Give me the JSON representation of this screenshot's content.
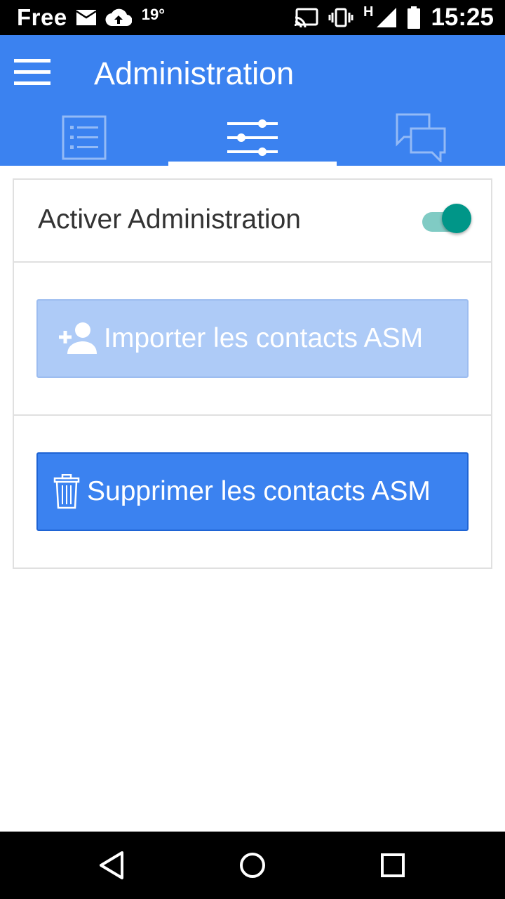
{
  "status_bar": {
    "carrier": "Free",
    "temperature": "19°",
    "network_type": "H",
    "time": "15:25"
  },
  "app_bar": {
    "title": "Administration",
    "tabs": [
      {
        "icon": "list-icon",
        "active": false
      },
      {
        "icon": "sliders-icon",
        "active": true
      },
      {
        "icon": "chat-icon",
        "active": false
      }
    ]
  },
  "admin": {
    "toggle_label": "Activer Administration",
    "toggle_on": true,
    "import_label": "Importer les contacts ASM",
    "import_enabled": false,
    "delete_label": "Supprimer les contacts ASM",
    "delete_enabled": true
  },
  "colors": {
    "primary": "#3b82f0",
    "primary_disabled": "#aecbf7",
    "toggle_thumb": "#009688",
    "toggle_track": "#80cbc4"
  }
}
